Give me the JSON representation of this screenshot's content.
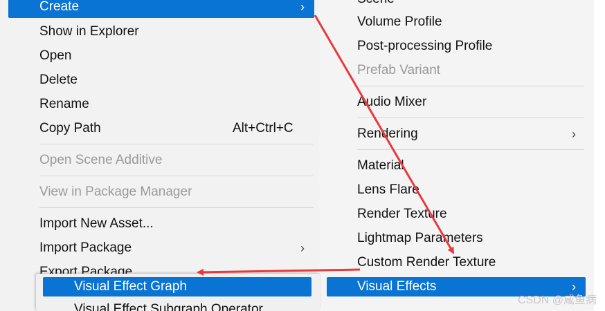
{
  "left_menu": {
    "items": [
      {
        "label": "Create",
        "shortcut": "",
        "arrow": "›"
      },
      {
        "label": "Show in Explorer",
        "shortcut": ""
      },
      {
        "label": "Open",
        "shortcut": ""
      },
      {
        "label": "Delete",
        "shortcut": ""
      },
      {
        "label": "Rename",
        "shortcut": ""
      },
      {
        "label": "Copy Path",
        "shortcut": "Alt+Ctrl+C"
      },
      {
        "label": "Open Scene Additive",
        "shortcut": ""
      },
      {
        "label": "View in Package Manager",
        "shortcut": ""
      },
      {
        "label": "Import New Asset...",
        "shortcut": ""
      },
      {
        "label": "Import Package",
        "shortcut": "",
        "arrow": "›"
      },
      {
        "label": "Export Package...",
        "shortcut": ""
      }
    ]
  },
  "right_menu": {
    "items": [
      {
        "label": "Scene"
      },
      {
        "label": "Volume Profile"
      },
      {
        "label": "Post-processing Profile"
      },
      {
        "label": "Prefab Variant"
      },
      {
        "label": "Audio Mixer"
      },
      {
        "label": "Rendering",
        "arrow": "›"
      },
      {
        "label": "Material"
      },
      {
        "label": "Lens Flare"
      },
      {
        "label": "Render Texture"
      },
      {
        "label": "Lightmap Parameters"
      },
      {
        "label": "Custom Render Texture"
      },
      {
        "label": "Visual Effects",
        "arrow": "›"
      }
    ]
  },
  "sub_menu": {
    "items": [
      {
        "label": "Visual Effect Graph"
      },
      {
        "label": "Visual Effect Subgraph Operator"
      }
    ]
  },
  "watermark": "CSDN @咸鱼病",
  "colors": {
    "highlight": "#0a74d4",
    "arrow": "#e8393c",
    "disabled_text": "#9a9a9a"
  }
}
